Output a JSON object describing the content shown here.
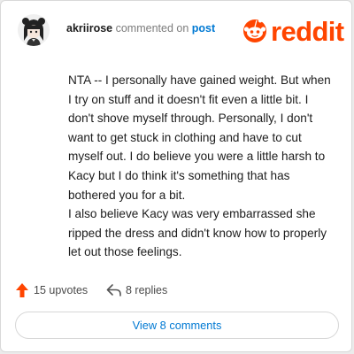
{
  "header": {
    "username": "akriirose",
    "action_text": "commented on",
    "target_link": "post",
    "avatar_icon": "user-avatar-icon",
    "logo_text": "reddit",
    "logo_icon": "reddit-snoo-icon",
    "brand_color": "#ff4500",
    "link_color": "#0079d3"
  },
  "comment": {
    "body": "NTA -- I personally have gained weight. But when I try on stuff and it doesn't fit even a little bit. I don't shove myself through. Personally, I don't want to get stuck in clothing and have to cut myself out. I do believe you were a little harsh to Kacy but I do think it's something that has bothered you for a bit.\nI also believe Kacy was very embarrassed she ripped the dress and didn't know how to properly let out those feelings."
  },
  "actions": {
    "upvotes_label": "15 upvotes",
    "upvote_icon": "upvote-arrow-icon",
    "replies_label": "8 replies",
    "reply_icon": "reply-arrow-icon"
  },
  "footer": {
    "view_comments_label": "View 8 comments"
  }
}
